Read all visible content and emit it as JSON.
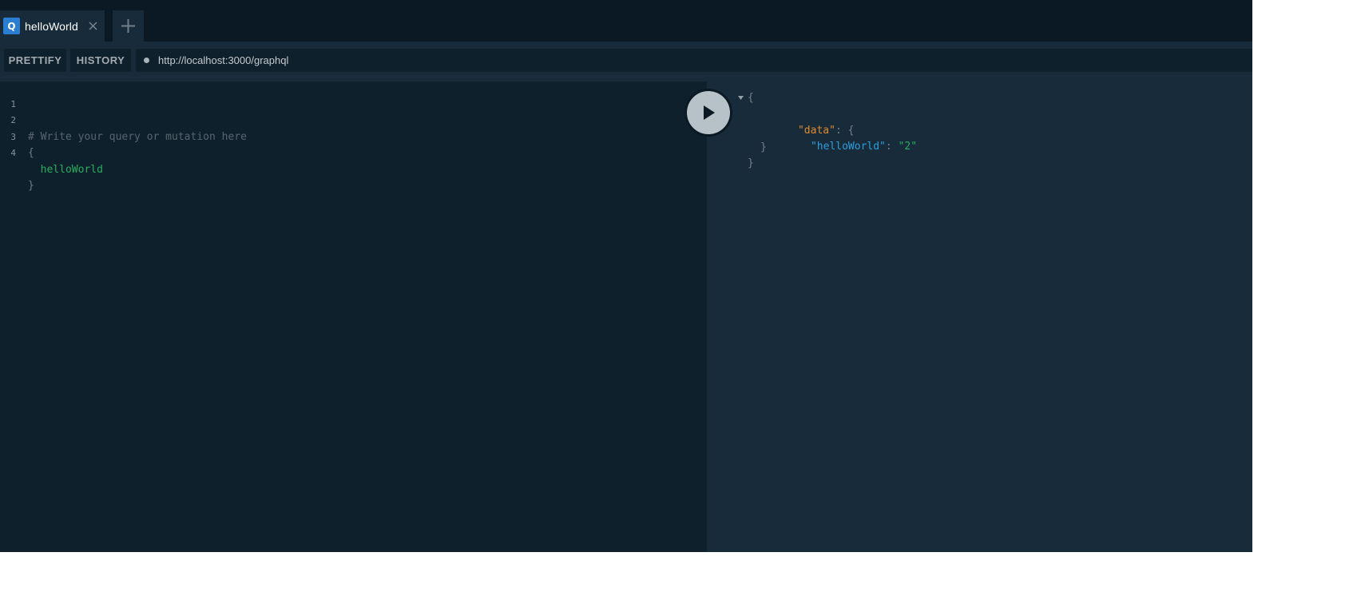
{
  "tabs": [
    {
      "badge": "Q",
      "title": "helloWorld"
    }
  ],
  "toolbar": {
    "prettify_label": "PRETTIFY",
    "history_label": "HISTORY",
    "endpoint_url": "http://localhost:3000/graphql"
  },
  "editor": {
    "lines": [
      {
        "number": "1",
        "text": "# Write your query or mutation here"
      },
      {
        "number": "2",
        "text": "{"
      },
      {
        "number": "3",
        "text": "  helloWorld"
      },
      {
        "number": "4",
        "text": "}"
      }
    ]
  },
  "result": {
    "open_brace": "{",
    "data_key": "\"data\"",
    "colon_brace": ": {",
    "field_key": "\"helloWorld\"",
    "colon": ": ",
    "field_value": "\"2\"",
    "inner_close": "}",
    "outer_close": "}"
  },
  "icons": {
    "close": "close-icon",
    "add": "plus-icon",
    "run": "play-icon",
    "fold": "triangle-down-icon"
  },
  "colors": {
    "background": "#0f202d",
    "panel": "#172b3a",
    "tab_badge": "#2a7ed2",
    "field_green": "#27ae60",
    "key_orange": "#e18a2b",
    "key_blue": "#2b9edb"
  }
}
